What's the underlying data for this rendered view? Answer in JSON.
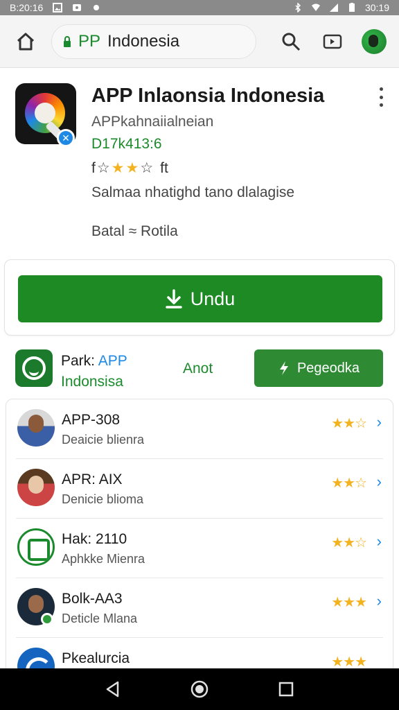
{
  "status_bar": {
    "left_time": "B:20:16",
    "right_time": "30:19"
  },
  "address_bar": {
    "url_prefix": "PP",
    "url_text": "Indonesia"
  },
  "app": {
    "title": "APP Inlaonsia Indonesia",
    "developer": "APPkahnaiialneian",
    "downloads": "D17k413:6",
    "rating_text": "f",
    "rating_suffix": "ft",
    "description": "Salmaa nhatighd tano dlalagise",
    "category": "Batal ≈ Rotila"
  },
  "download": {
    "label": "Undu"
  },
  "promo": {
    "name_prefix": "Park:",
    "name_highlight": "APP",
    "name_line2": "Indonsisa",
    "link_label": "Anot",
    "button_label": "Pegeodka"
  },
  "list": [
    {
      "title": "APP-308",
      "subtitle": "Deaicie blienra",
      "stars_full": 2,
      "stars_empty": 1
    },
    {
      "title": "APR: AIX",
      "subtitle": "Denicie blioma",
      "stars_full": 2,
      "stars_empty": 1
    },
    {
      "title": "Hak: 2110",
      "subtitle": "Aphkke Mienra",
      "stars_full": 2,
      "stars_empty": 1
    },
    {
      "title": "Bolk-AA3",
      "subtitle": "Deticle Mlana",
      "stars_full": 3,
      "stars_empty": 0
    },
    {
      "title": "Pkealurcia",
      "subtitle": "",
      "stars_full": 3,
      "stars_empty": 0
    }
  ],
  "colors": {
    "primary_green": "#1e8a23",
    "star_gold": "#f3b320",
    "link_blue": "#1e88e5"
  }
}
